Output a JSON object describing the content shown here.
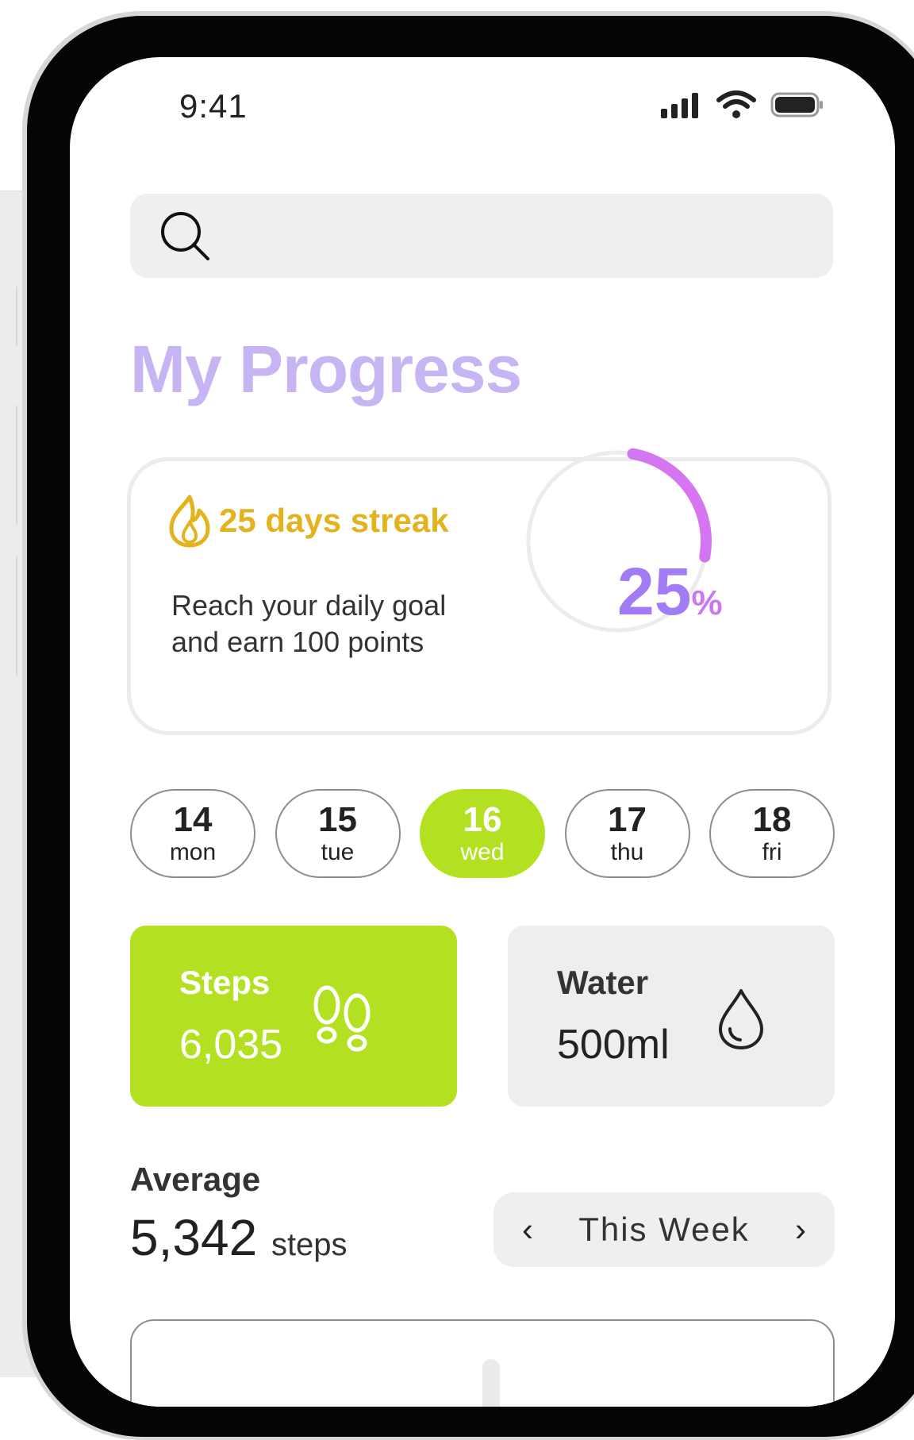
{
  "status_bar": {
    "time": "9:41"
  },
  "search": {
    "placeholder": ""
  },
  "page": {
    "title": "My Progress"
  },
  "streak": {
    "label": "25 days streak",
    "goal_line1": "Reach your daily goal",
    "goal_line2": "and earn 100 points",
    "percent_value": "25",
    "percent_symbol": "%",
    "progress_fraction": 0.25
  },
  "days": [
    {
      "num": "14",
      "name": "mon",
      "active": false
    },
    {
      "num": "15",
      "name": "tue",
      "active": false
    },
    {
      "num": "16",
      "name": "wed",
      "active": true
    },
    {
      "num": "17",
      "name": "thu",
      "active": false
    },
    {
      "num": "18",
      "name": "fri",
      "active": false
    }
  ],
  "stats": {
    "steps": {
      "label": "Steps",
      "value": "6,035"
    },
    "water": {
      "label": "Water",
      "value": "500ml"
    }
  },
  "average": {
    "label": "Average",
    "value": "5,342",
    "unit": "steps"
  },
  "week_selector": {
    "label": "This Week"
  },
  "colors": {
    "accent_purple": "#a27cf4",
    "title_lavender": "#c7b4f3",
    "streak_gold": "#e3b21d",
    "active_green": "#b3e122"
  }
}
